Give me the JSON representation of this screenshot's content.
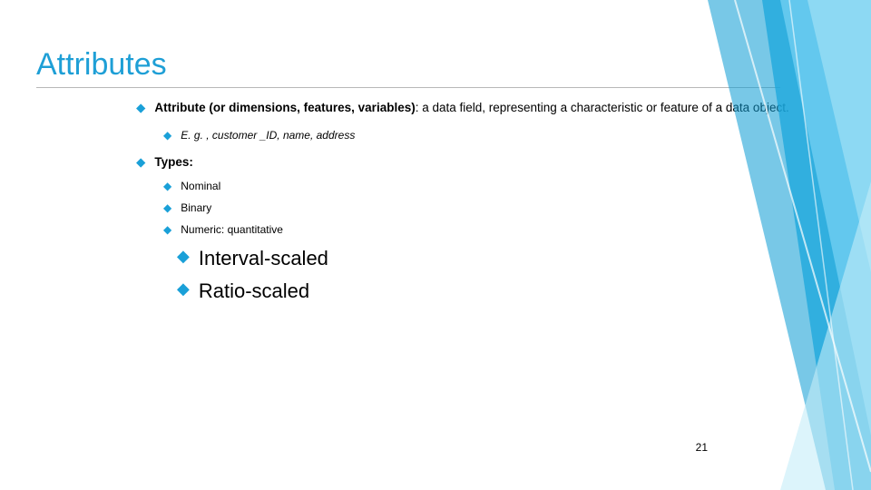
{
  "title": "Attributes",
  "def": {
    "bold": "Attribute (or dimensions, features, variables)",
    "rest": ": a data field, representing a characteristic or feature of a data object."
  },
  "example": "E. g. , customer _ID, name, address",
  "types_label": "Types:",
  "types": {
    "nominal": "Nominal",
    "binary": "Binary",
    "numeric": "Numeric: quantitative"
  },
  "scales": {
    "interval": "Interval-scaled",
    "ratio": "Ratio-scaled"
  },
  "page_number": "21"
}
